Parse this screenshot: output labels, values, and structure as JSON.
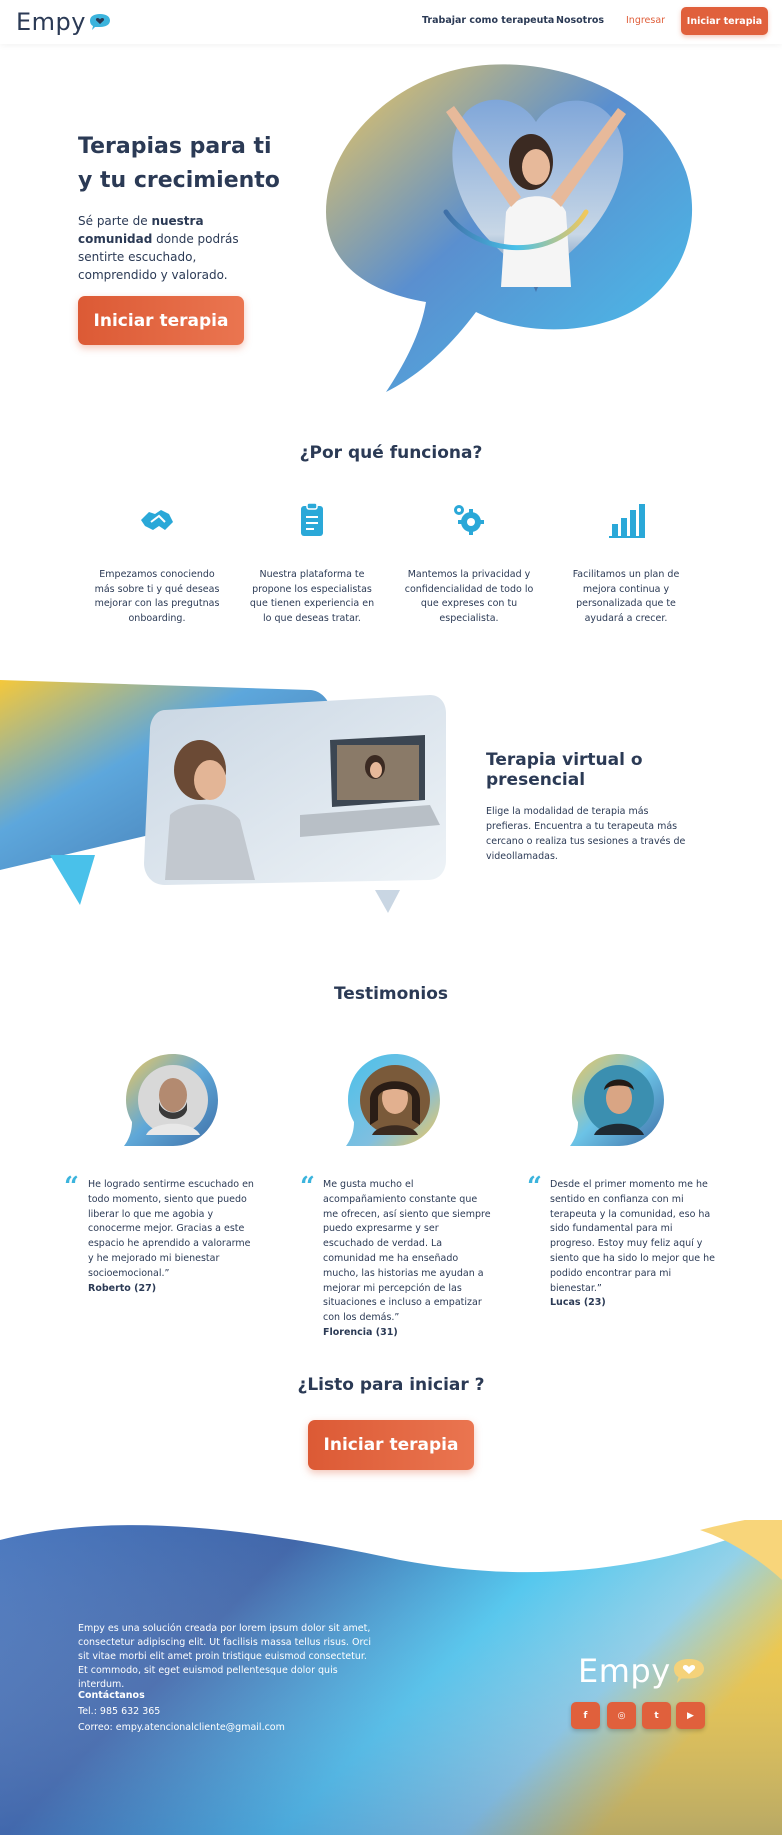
{
  "header": {
    "logo_text": "Empy",
    "nav": {
      "work": "Trabajar como terapeuta",
      "about": "Nosotros",
      "login": "Ingresar",
      "cta": "Iniciar terapia"
    }
  },
  "hero": {
    "title_line1": "Terapias para ti",
    "title_line2": "y tu crecimiento",
    "desc_prefix": "Sé parte de ",
    "desc_bold": "nuestra comunidad",
    "desc_suffix": " donde podrás sentirte escuchado, comprendido y valorado.",
    "cta": "Iniciar terapia"
  },
  "why": {
    "title": "¿Por qué funciona?",
    "features": [
      {
        "icon": "handshake-icon",
        "text": "Empezamos conociendo más sobre ti y qué deseas mejorar con las pregutnas onboarding."
      },
      {
        "icon": "clipboard-icon",
        "text": "Nuestra plataforma te propone los especialistas que tienen experiencia en lo que deseas tratar."
      },
      {
        "icon": "gears-icon",
        "text": "Mantemos la privacidad y confidencialidad de todo lo que expreses con tu especialista."
      },
      {
        "icon": "bar-chart-icon",
        "text": "Facilitamos un plan de mejora continua y personalizada que te ayudará a crecer."
      }
    ]
  },
  "virtual": {
    "title": "Terapia virtual o presencial",
    "desc": "Elige la modalidad de terapia más prefieras. Encuentra a tu terapeuta más cercano o realiza tus sesiones a través de videollamadas."
  },
  "testimonials": {
    "title": "Testimonios",
    "items": [
      {
        "text": "He logrado sentirme escuchado en todo momento, siento que puedo liberar lo que me agobia y conocerme mejor. Gracias a este espacio he aprendido a valorarme y he mejorado mi bienestar socioemocional.”",
        "name": "Roberto (27)"
      },
      {
        "text": "Me gusta mucho el acompañamiento constante que me ofrecen, así siento que siempre puedo expresarme y ser escuchado de verdad. La comunidad me ha enseñado mucho, las historias me ayudan a mejorar mi percepción de las situaciones e incluso a empatizar con los demás.”",
        "name": "Florencia  (31)"
      },
      {
        "text": "Desde el primer momento me he sentido en confianza con mi terapeuta y la comunidad, eso ha sido fundamental para mi progreso. Estoy muy feliz aquí y siento que ha sido lo mejor que he podido encontrar para mi bienestar.”",
        "name": "Lucas (23)"
      }
    ]
  },
  "ready": {
    "title": "¿Listo para iniciar ?",
    "cta": "Iniciar terapia"
  },
  "footer": {
    "about": "Empy es una solución creada por lorem ipsum dolor sit amet, consectetur adipiscing elit. Ut facilisis massa tellus risus. Orci sit vitae morbi elit amet proin tristique euismod consectetur. Et commodo, sit eget euismod pellentesque dolor quis interdum.",
    "contact_title": "Contáctanos",
    "tel": "Tel.: 985 632 365",
    "mail": "Correo: empy.atencionalcliente@gmail.com",
    "logo_text": "Empy",
    "social": [
      {
        "icon": "facebook-icon",
        "glyph": "f"
      },
      {
        "icon": "instagram-icon",
        "glyph": "◎"
      },
      {
        "icon": "twitter-icon",
        "glyph": "t"
      },
      {
        "icon": "youtube-icon",
        "glyph": "▶"
      }
    ]
  },
  "colors": {
    "primary": "#2b3a55",
    "accent": "#e0603c",
    "blue": "#3cb4dd",
    "yellow": "#f5c83a"
  }
}
